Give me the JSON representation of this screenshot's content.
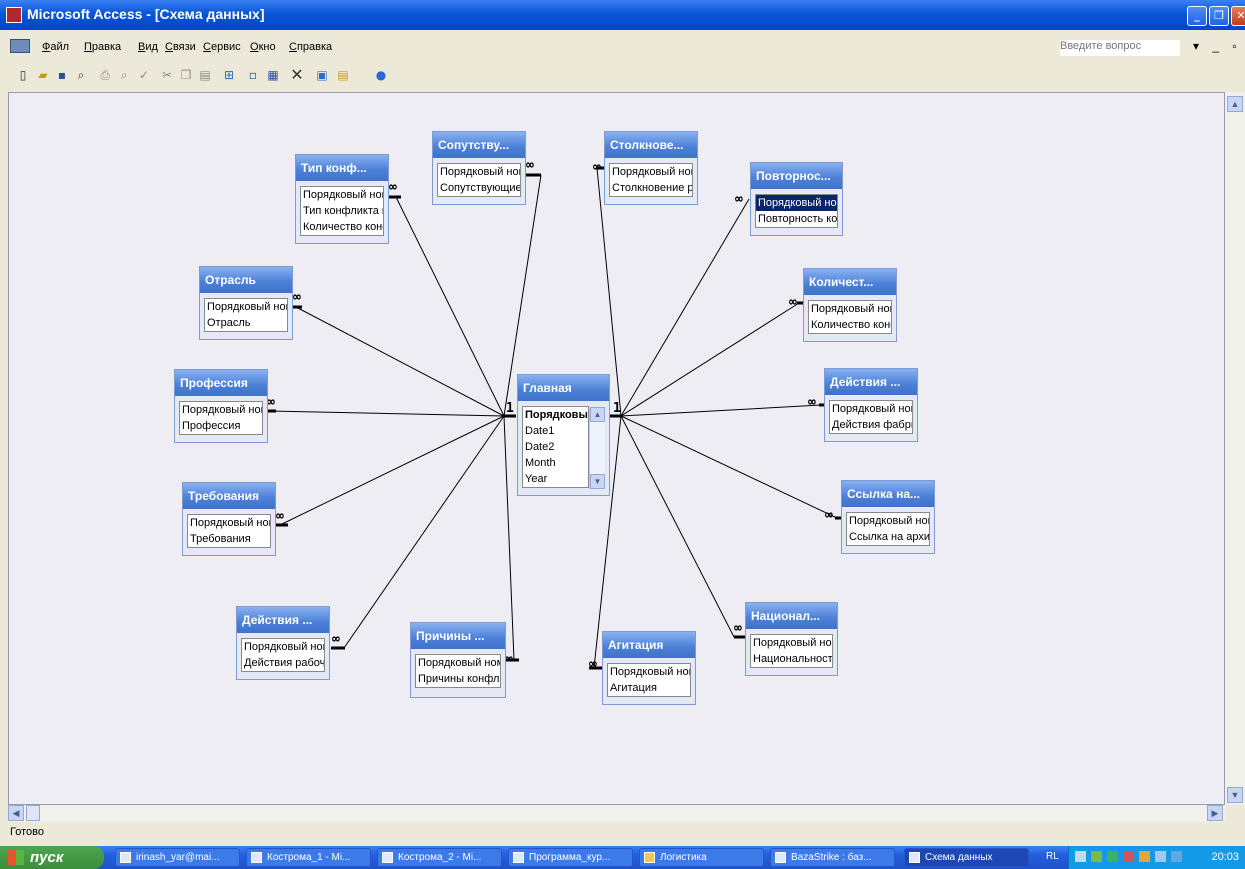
{
  "window": {
    "title": "Microsoft Access - [Схема данных]",
    "minimize": "_",
    "restore": "❐",
    "close": "✕"
  },
  "menu": {
    "items": [
      "Файл",
      "Правка",
      "Вид",
      "Связи",
      "Сервис",
      "Окно",
      "Справка"
    ],
    "help_placeholder": "Введите вопрос",
    "doc_controls": "▾ _ ▫ ×"
  },
  "toolbar": {
    "icons": [
      "new-icon",
      "open-icon",
      "save-icon",
      "file-search-icon",
      "print-icon",
      "print-preview-icon",
      "spelling-icon",
      "cut-icon",
      "copy-icon",
      "paste-icon",
      "show-table-icon",
      "show-direct-icon",
      "show-all-icon",
      "delete-icon",
      "database-window-icon",
      "new-object-icon",
      "help-icon"
    ]
  },
  "relations": {
    "one_label": "1",
    "many_label": "∞"
  },
  "tables": {
    "main": {
      "title": "Главная",
      "fields": [
        "Порядковый",
        "Date1",
        "Date2",
        "Month",
        "Year"
      ]
    },
    "conflict_type": {
      "title": "Тип конф...",
      "fields": [
        "Порядковый ном",
        "Тип конфликта в",
        "Количество конф"
      ]
    },
    "accompanying": {
      "title": "Сопутству...",
      "fields": [
        "Порядковый ном",
        "Сопутствующие"
      ]
    },
    "collision": {
      "title": "Столкнове...",
      "fields": [
        "Порядковый ном",
        "Столкновение р"
      ]
    },
    "repeat": {
      "title": "Повторнос...",
      "fields": [
        "Порядковый ном",
        "Повторность ко"
      ]
    },
    "industry": {
      "title": "Отрасль",
      "fields": [
        "Порядковый ном",
        "Отрасль"
      ]
    },
    "count": {
      "title": "Количест...",
      "fields": [
        "Порядковый ном",
        "Количество конф"
      ]
    },
    "profession": {
      "title": "Профессия",
      "fields": [
        "Порядковый ном",
        "Профессия"
      ]
    },
    "factory_actions": {
      "title": "Действия ...",
      "fields": [
        "Порядковый ном",
        "Действия фабри"
      ]
    },
    "demands": {
      "title": "Требования",
      "fields": [
        "Порядковый ном",
        "Требования"
      ]
    },
    "archive_link": {
      "title": "Ссылка на...",
      "fields": [
        "Порядковый ном",
        "Ссылка на архив"
      ]
    },
    "worker_actions": {
      "title": "Действия ...",
      "fields": [
        "Порядковый ном",
        "Действия рабоч"
      ]
    },
    "causes": {
      "title": "Причины ...",
      "fields": [
        "Порядковый ном",
        "Причины конфли"
      ]
    },
    "agitation": {
      "title": "Агитация",
      "fields": [
        "Порядковый ном",
        "Агитация"
      ]
    },
    "nationality": {
      "title": "Национал...",
      "fields": [
        "Порядковый ном",
        "Национальность"
      ]
    }
  },
  "status": "Готово",
  "taskbar": {
    "start": "пуск",
    "tasks": [
      "irinash_yar@mai...",
      "Кострома_1 - Mi...",
      "Кострома_2 - Mi...",
      "Программа_кур...",
      "Логистика",
      "BazaStrike : баз...",
      "Схема данных"
    ],
    "lang": "RL",
    "clock": "20:03"
  },
  "colors": {
    "titlebar": "#0a55d8",
    "table_header": "#4e82d8",
    "taskbar": "#245ddb",
    "start": "#3b8e3b",
    "tray": "#129ae8"
  }
}
